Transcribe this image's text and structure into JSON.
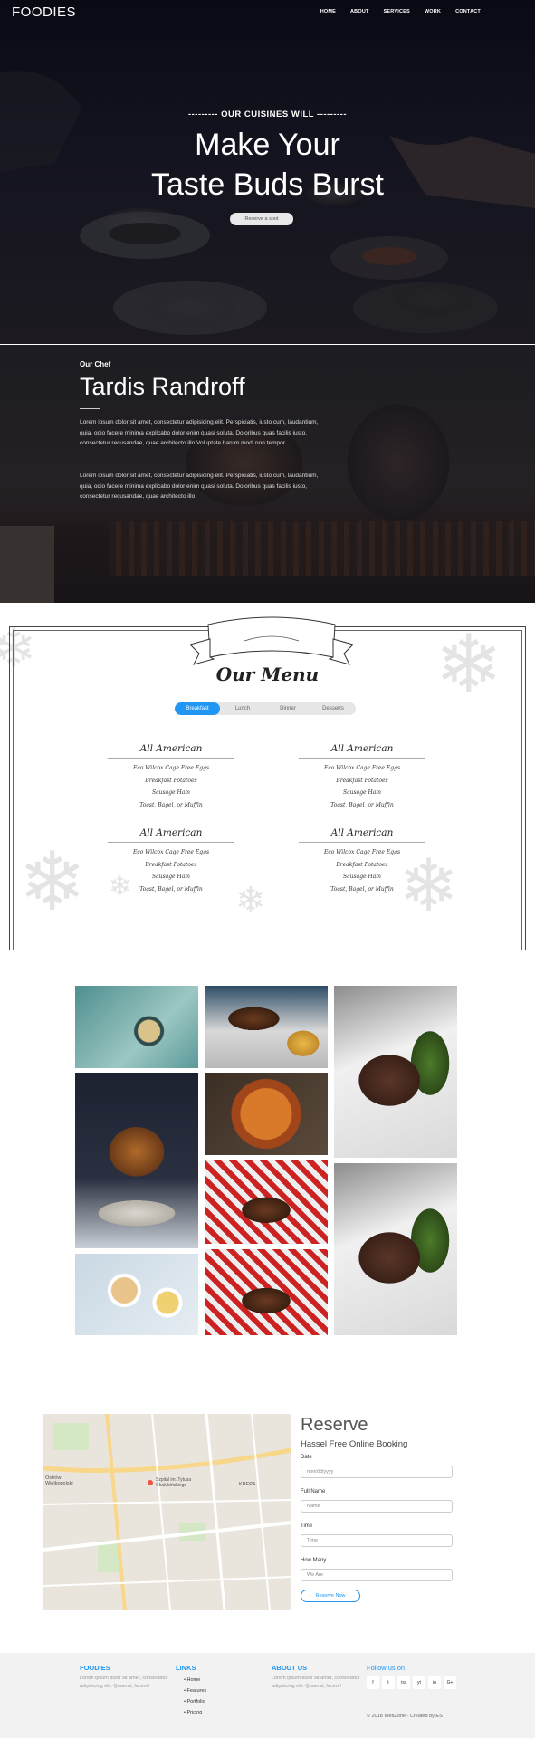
{
  "nav": {
    "logo": "FOODIES",
    "items": [
      "HOME",
      "ABOUT",
      "SERVICES",
      "WORK",
      "CONTACT"
    ]
  },
  "hero": {
    "tagline": "--------- OUR CUISINES WILL ---------",
    "title_line1": "Make Your",
    "title_line2": "Taste Buds Burst",
    "button": "Reserve a spot"
  },
  "chef": {
    "label": "Our Chef",
    "name": "Tardis Randroff",
    "para1": "Lorem ipsum dolor sit amet, consectetur adipisicing elit. Perspiciatis, iusto cum, laudantium, quia, odio facere minima explicabo dolor enim quasi soluta. Doloribus quas facilis iusto, consectetur recusandae, quae architecto illo Voluptate harum modi non tempor",
    "para2": "Lorem ipsum dolor sit amet, consectetur adipisicing elit. Perspiciatis, iusto cum, laudantium, quia, odio facere minima explicabo dolor enim quasi soluta. Doloribus quas facilis iusto, consectetur recusandae, quae architecto illo"
  },
  "menu": {
    "title": "Our Menu",
    "tabs": [
      "Breakfast",
      "Lunch",
      "Dinner",
      "Desserts"
    ],
    "active_tab": "Breakfast",
    "columns": [
      {
        "heading": "All American",
        "items": [
          "Eco Wilcox Cage Free Eggs",
          "Breakfast Potatoes",
          "Sausage Ham",
          "Toast, Bagel, or Muffin"
        ]
      },
      {
        "heading": "All American",
        "items": [
          "Eco Wilcox Cage Free Eggs",
          "Breakfast Potatoes",
          "Sausage Ham",
          "Toast, Bagel, or Muffin"
        ]
      },
      {
        "heading": "All American",
        "items": [
          "Eco Wilcox Cage Free Eggs",
          "Breakfast Potatoes",
          "Sausage Ham",
          "Toast, Bagel, or Muffin"
        ]
      },
      {
        "heading": "All American",
        "items": [
          "Eco Wilcox Cage Free Eggs",
          "Breakfast Potatoes",
          "Sausage Ham",
          "Toast, Bagel, or Muffin"
        ]
      }
    ]
  },
  "reserve": {
    "title": "Reserve",
    "subtitle": "Hassel Free Online Booking",
    "fields": [
      {
        "label": "Date",
        "placeholder": "mm/dd/yyyy"
      },
      {
        "label": "Full Name",
        "placeholder": "Name"
      },
      {
        "label": "Time",
        "placeholder": "Time"
      },
      {
        "label": "How Many",
        "placeholder": "We Are"
      }
    ],
    "button": "Reserve Now",
    "map_labels": [
      "Ostrów Wielkopolski",
      "Szpital im. Tytusa Chałubińskiego",
      "KREPA"
    ]
  },
  "footer": {
    "col1": {
      "heading": "FOODIES",
      "text": "Lorem ipsum dolor sit amet, consectetur adipisicing elit. Quaerat, facere!"
    },
    "col2": {
      "heading": "LINKS",
      "links": [
        "Home",
        "Features",
        "Portfolio",
        "Pricing"
      ]
    },
    "col3": {
      "heading": "ABOUT US",
      "text": "Lorem ipsum dolor sit amet, consectetur adipisicing elit. Quaerat, facere!"
    },
    "col4": {
      "heading": "Follow us on",
      "social": [
        "f",
        "t",
        "rss",
        "yt",
        "in",
        "G+"
      ]
    },
    "copyright": "© 2018 WebZone - Created by ES"
  }
}
